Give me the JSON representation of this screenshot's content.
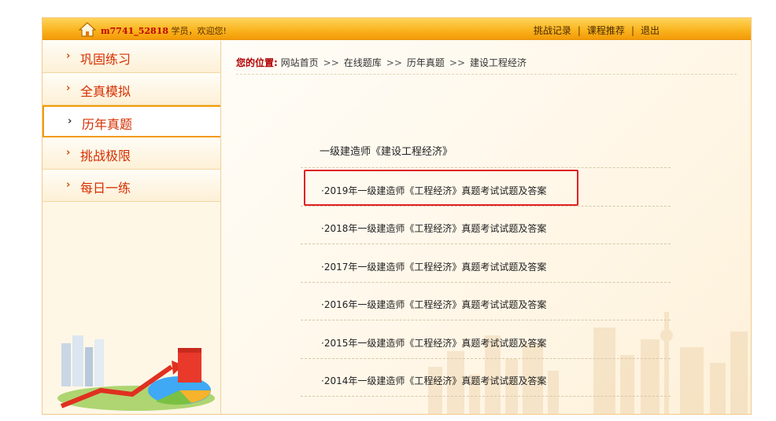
{
  "header": {
    "username": "m7741_52818",
    "greeting": "学员，欢迎您!",
    "links": [
      "挑战记录",
      "课程推荐",
      "退出"
    ],
    "separator": "|"
  },
  "sidebar": {
    "items": [
      {
        "label": "巩固练习",
        "active": false
      },
      {
        "label": "全真模拟",
        "active": false
      },
      {
        "label": "历年真题",
        "active": true
      },
      {
        "label": "挑战极限",
        "active": false
      },
      {
        "label": "每日一练",
        "active": false
      }
    ],
    "chevron": "›"
  },
  "breadcrumb": {
    "prefix": "您的位置:",
    "items": [
      "网站首页",
      "在线题库",
      "历年真题",
      "建设工程经济"
    ],
    "separator": ">>"
  },
  "main": {
    "section_title": "一级建造师《建设工程经济》",
    "exams": [
      "·2019年一级建造师《工程经济》真题考试试题及答案",
      "·2018年一级建造师《工程经济》真题考试试题及答案",
      "·2017年一级建造师《工程经济》真题考试试题及答案",
      "·2016年一级建造师《工程经济》真题考试试题及答案",
      "·2015年一级建造师《工程经济》真题考试试题及答案",
      "·2014年一级建造师《工程经济》真题考试试题及答案"
    ]
  },
  "icons": {
    "home": "home-icon",
    "illustration": "city-growth-chart-illustration",
    "background": "city-skyline-background"
  },
  "colors": {
    "topbar": "#f9b21c",
    "accent_red": "#d62f00",
    "highlight": "#e02020",
    "border": "#f39a08"
  }
}
